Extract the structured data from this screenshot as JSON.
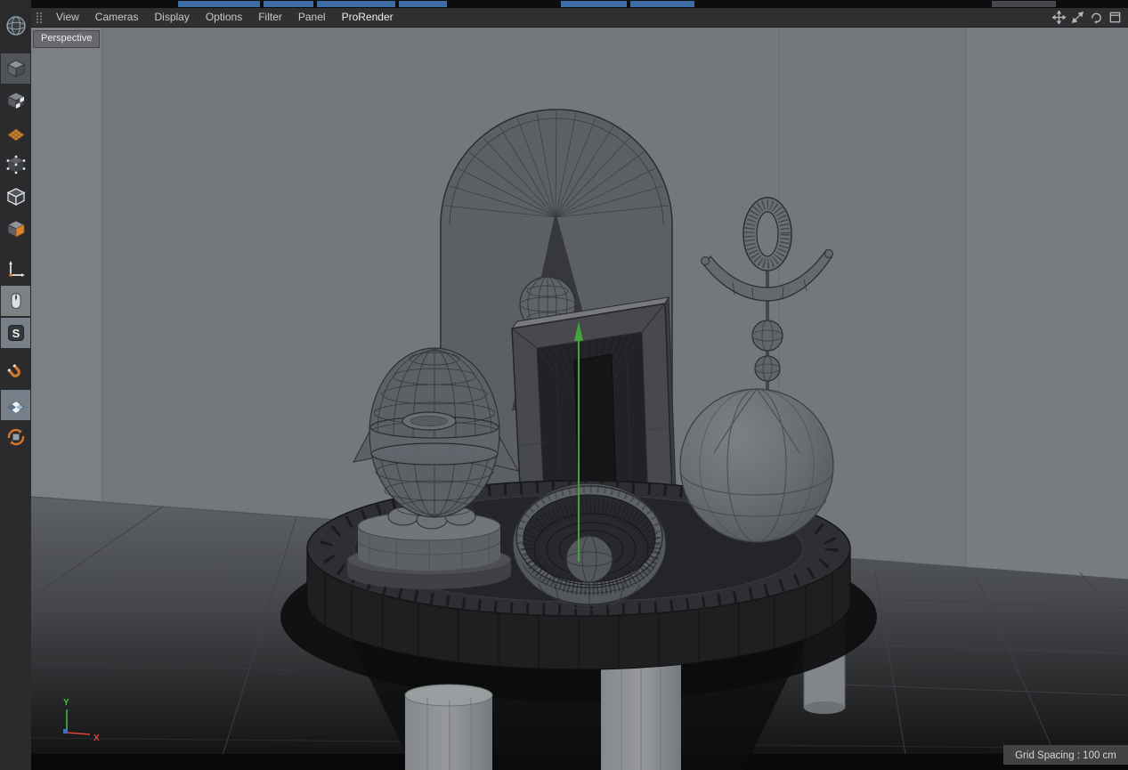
{
  "menubar": {
    "items": [
      "View",
      "Cameras",
      "Display",
      "Options",
      "Filter",
      "Panel",
      "ProRender"
    ],
    "right_icons": [
      {
        "name": "pan-icon"
      },
      {
        "name": "zoom-icon"
      },
      {
        "name": "rotate-icon"
      },
      {
        "name": "maximize-view-icon"
      }
    ]
  },
  "viewport": {
    "label": "Perspective",
    "grid_spacing": "Grid Spacing : 100 cm",
    "axis_labels": {
      "x": "X",
      "y": "Y"
    },
    "colors": {
      "background": "#74777c",
      "x_axis": "#e04338",
      "y_axis": "#3ec43e",
      "z_axis": "#3a6fd8",
      "gizmo_green": "#43a33c",
      "selection_highlight": "#75808a"
    }
  },
  "toolbar": {
    "items": [
      {
        "name": "model-mode",
        "selected": true
      },
      {
        "name": "texture-mode",
        "selected": false
      },
      {
        "name": "workplane-mode",
        "selected": false
      },
      {
        "name": "points-mode",
        "selected": false
      },
      {
        "name": "edges-mode",
        "selected": false
      },
      {
        "name": "polygons-mode",
        "selected": false
      },
      {
        "name": "axis-mode",
        "selected": false
      },
      {
        "name": "tweak-mode",
        "selected": true
      },
      {
        "name": "viewport-solo",
        "selected": true
      },
      {
        "name": "snapping",
        "selected": false
      },
      {
        "name": "quantize-mode",
        "selected": true
      },
      {
        "name": "workplane-lock",
        "selected": false
      }
    ]
  },
  "scene": {
    "objects": [
      "arch",
      "monolith",
      "small-sphere",
      "egg-figure",
      "bowl",
      "sphere",
      "ring-ornament",
      "round-table"
    ]
  }
}
